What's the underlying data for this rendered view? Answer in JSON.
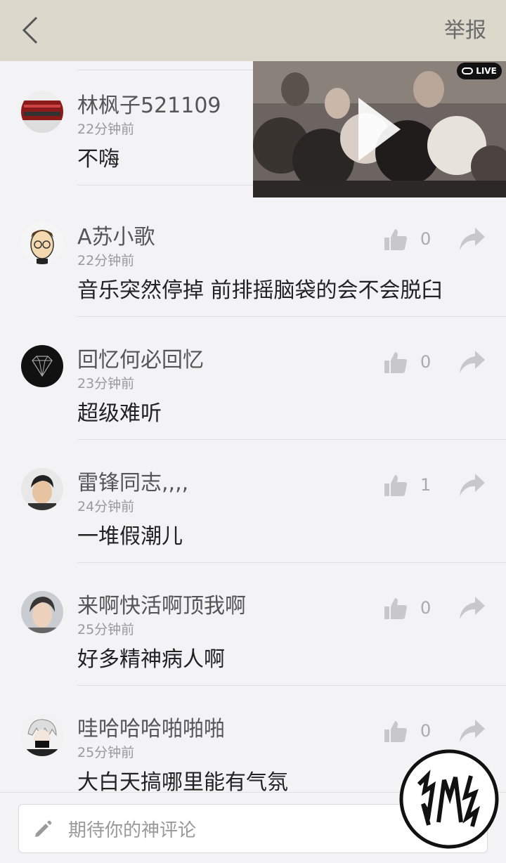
{
  "header": {
    "back_icon": "chevron-left-icon",
    "report_label": "举报",
    "background": "#dcd8cc"
  },
  "video": {
    "badge": "LIVE",
    "play_icon": "play-icon"
  },
  "comments": [
    {
      "username": "林枫子521109",
      "time": "22分钟前",
      "content": "不嗨"
    },
    {
      "username": "A苏小歌",
      "time": "22分钟前",
      "content": "音乐突然停掉 前排摇脑袋的会不会脱臼",
      "likes": "0"
    },
    {
      "username": "回忆何必回忆",
      "time": "23分钟前",
      "content": "超级难听",
      "likes": "0"
    },
    {
      "username": "雷锋同志,,,,",
      "time": "24分钟前",
      "content": "一堆假潮儿",
      "likes": "1"
    },
    {
      "username": "来啊快活啊顶我啊",
      "time": "25分钟前",
      "content": "好多精神病人啊",
      "likes": "0"
    },
    {
      "username": "哇哈哈哈啪啪啪",
      "time": "25分钟前",
      "content": "大白天搞哪里能有气氛",
      "likes": "0"
    }
  ],
  "composer": {
    "placeholder": "期待你的神评论",
    "icon": "pencil-icon"
  },
  "colors": {
    "text_primary": "#222222",
    "text_secondary": "#999999",
    "icon_gray": "#c8c8cc"
  }
}
